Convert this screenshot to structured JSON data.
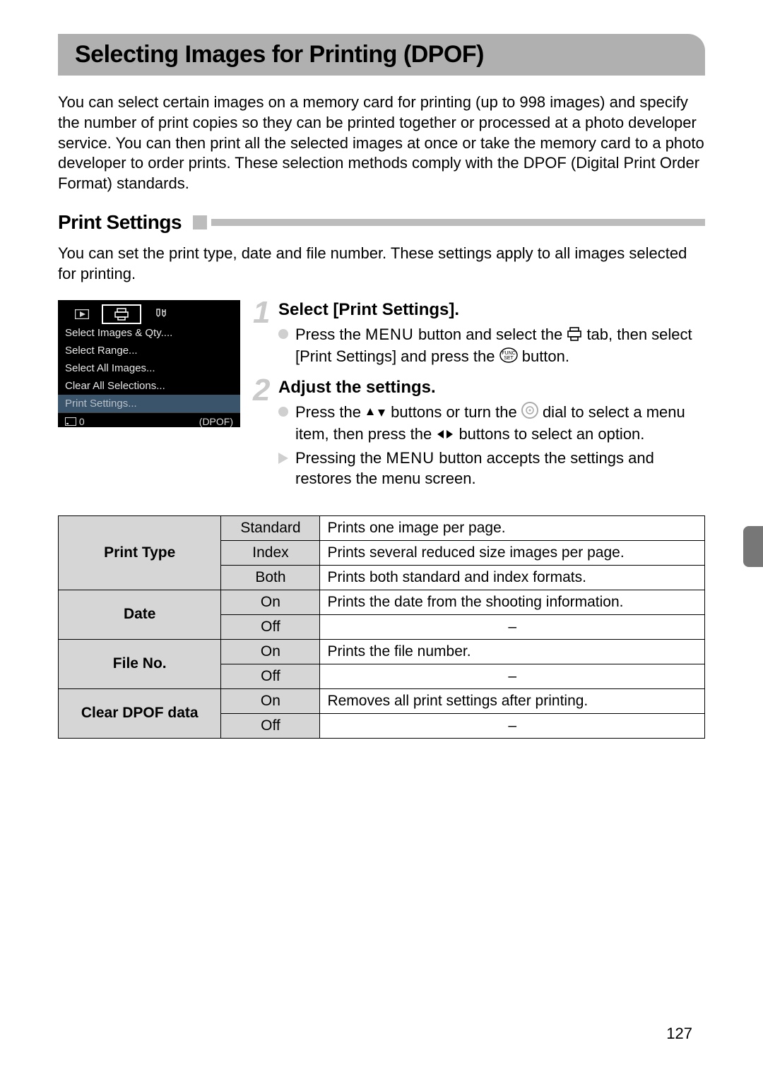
{
  "title": "Selecting Images for Printing (DPOF)",
  "intro": "You can select certain images on a memory card for printing (up to 998 images) and specify the number of print copies so they can be printed together or processed at a photo developer service. You can then print all the selected images at once or take the memory card to a photo developer to order prints. These selection methods comply with the DPOF (Digital Print Order Format) standards.",
  "section_title": "Print Settings",
  "section_intro": "You can set the print type, date and file number. These settings apply to all images selected for printing.",
  "camera_menu": {
    "items": [
      "Select Images & Qty....",
      "Select Range...",
      "Select All Images...",
      "Clear All Selections...",
      "Print Settings..."
    ],
    "bottom_left": "0",
    "bottom_right": "(DPOF)"
  },
  "steps": {
    "s1": {
      "num": "1",
      "title": "Select [Print Settings].",
      "line1a": "Press the ",
      "menu_word": "MENU",
      "line1b": " button and select the ",
      "line1c": " tab, then select [Print Settings] and press the ",
      "line1d": " button."
    },
    "s2": {
      "num": "2",
      "title": "Adjust the settings.",
      "line1a": "Press the ",
      "line1b": " buttons or turn the ",
      "line1c": " dial to select a menu item, then press the ",
      "line1d": " buttons to select an option.",
      "line2a": "Pressing the ",
      "line2b": " button accepts the settings and restores the menu screen."
    }
  },
  "table": {
    "print_type": {
      "label": "Print Type",
      "r1o": "Standard",
      "r1d": "Prints one image per page.",
      "r2o": "Index",
      "r2d": "Prints several reduced size images per page.",
      "r3o": "Both",
      "r3d": "Prints both standard and index formats."
    },
    "date": {
      "label": "Date",
      "r1o": "On",
      "r1d": "Prints the date from the shooting information.",
      "r2o": "Off",
      "r2d": "–"
    },
    "file_no": {
      "label": "File No.",
      "r1o": "On",
      "r1d": "Prints the file number.",
      "r2o": "Off",
      "r2d": "–"
    },
    "clear": {
      "label": "Clear DPOF data",
      "r1o": "On",
      "r1d": "Removes all print settings after printing.",
      "r2o": "Off",
      "r2d": "–"
    }
  },
  "page_number": "127"
}
